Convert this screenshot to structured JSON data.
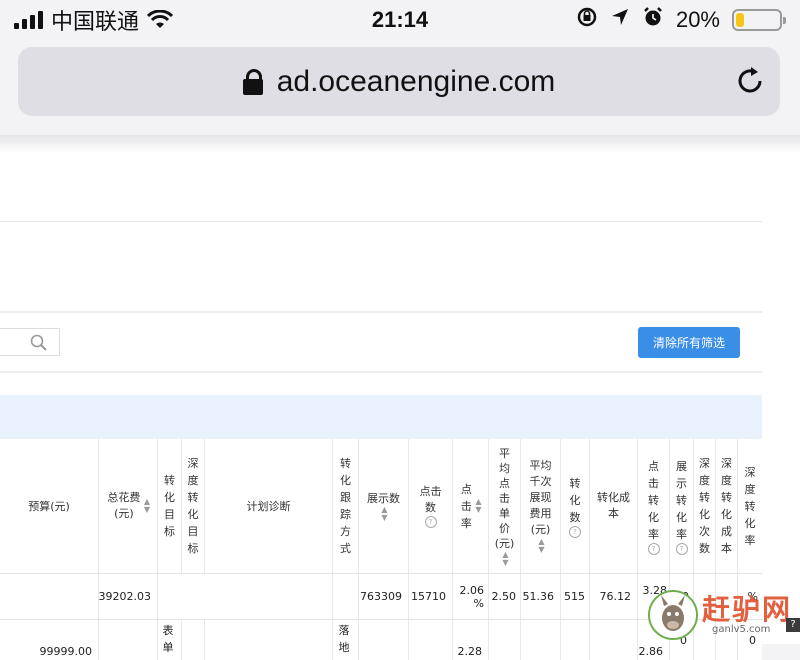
{
  "status_bar": {
    "carrier": "中国联通",
    "time": "21:14",
    "battery_percent": "20%",
    "battery_level": 0.2,
    "icons": [
      "signal-icon",
      "wifi-icon",
      "rotation-lock-icon",
      "location-icon",
      "alarm-icon",
      "battery-icon"
    ]
  },
  "url_bar": {
    "url": "ad.oceanengine.com"
  },
  "toolbar": {
    "clear_filters_label": "清除所有筛选"
  },
  "table": {
    "headers": {
      "budget": "预算(元)",
      "total_cost": "总花费(元)",
      "conv_target": "转化目标",
      "deep_conv_target": "深度转化目标",
      "plan_diagnosis": "计划诊断",
      "conv_tracking": "转化跟踪方式",
      "impressions": "展示数",
      "clicks": "点击数",
      "ctr": "点击率",
      "avg_cpc": "平均点击单价(元)",
      "avg_cpm": "平均千次展现费用(元)",
      "conversions": "转化数",
      "conv_cost": "转化成本",
      "click_conv_rate": "点击转化率",
      "impr_conv_rate": "展示转化率",
      "deep_conv_count": "深度转化次数",
      "deep_conv_cost": "深度转化成本",
      "deep_conv_rate": "深度转化率"
    },
    "total_row": {
      "total_cost": "39202.03",
      "impressions": "763309",
      "clicks": "15710",
      "ctr": "2.06 %",
      "avg_cpc": "2.50",
      "avg_cpm": "51.36",
      "conversions": "515",
      "conv_cost": "76.12",
      "click_conv_rate": "3.28 %",
      "impr_conv_rate": "0",
      "deep_conv_rate": "%"
    },
    "row_1": {
      "budget": "99999.00",
      "conv_target_partial": "表单",
      "conv_tracking_partial": "落地",
      "ctr_partial": "2.28",
      "click_conv_rate_partial": "2.86",
      "impr_conv_rate_partial": "0",
      "deep_conv_rate_partial": "0"
    }
  },
  "watermark": {
    "text": "赶驴网",
    "domain": "ganlv5.com"
  }
}
